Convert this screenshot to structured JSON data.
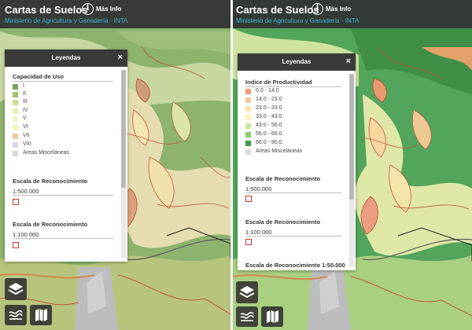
{
  "header": {
    "title": "Cartas de Suelos",
    "info_glyph": "i",
    "more_info": "Más Info",
    "subtitle": "Ministerio de Agricultura y Ganadería - INTA"
  },
  "legend": {
    "title": "Leyendas",
    "close": "×"
  },
  "left_panel": {
    "section": "Capacidad de Uso",
    "items": [
      {
        "label": "I",
        "color": "#7ba05b"
      },
      {
        "label": "II",
        "color": "#9bc36e"
      },
      {
        "label": "III",
        "color": "#c4e09a"
      },
      {
        "label": "IV",
        "color": "#e4f1b8"
      },
      {
        "label": "V",
        "color": "#f1f5c7"
      },
      {
        "label": "VI",
        "color": "#f6f3b8"
      },
      {
        "label": "VII",
        "color": "#efc9a3"
      },
      {
        "label": "VIII",
        "color": "#dcd9e8"
      },
      {
        "label": "Areas Misceláneas",
        "color": "#d9d9d9"
      }
    ],
    "scales": [
      {
        "title": "Escala de Reconocimiento",
        "value": "1:500.000"
      },
      {
        "title": "Escala de Reconocimiento",
        "value": "1:100.000"
      }
    ]
  },
  "right_panel": {
    "section": "Indice de Productividad",
    "items": [
      {
        "label": "0.0 - 14.0",
        "color": "#f19a7e"
      },
      {
        "label": "14.0 - 23.0",
        "color": "#f7c59a"
      },
      {
        "label": "23.0 - 33.0",
        "color": "#fbe3a8"
      },
      {
        "label": "33.0 - 43.0",
        "color": "#f6f5b0"
      },
      {
        "label": "43.0 - 56.0",
        "color": "#c6e79c"
      },
      {
        "label": "56.0 - 66.0",
        "color": "#8ccf78"
      },
      {
        "label": "66.0 - 90.0",
        "color": "#3f9a45"
      },
      {
        "label": "Areas Misceláneas",
        "color": "#d9d9d9"
      }
    ],
    "scales": [
      {
        "title": "Escala de Reconocimiento",
        "value": "1:500.000"
      },
      {
        "title": "Escala de Reconocimiento",
        "value": "1:100.000"
      },
      {
        "title": "Escala de Reconocimiento 1:50.000",
        "value": ""
      }
    ]
  },
  "controls": {
    "layers_icon": "layers-icon",
    "basemap_icon": "waves-icon",
    "map_icon": "map-icon"
  }
}
